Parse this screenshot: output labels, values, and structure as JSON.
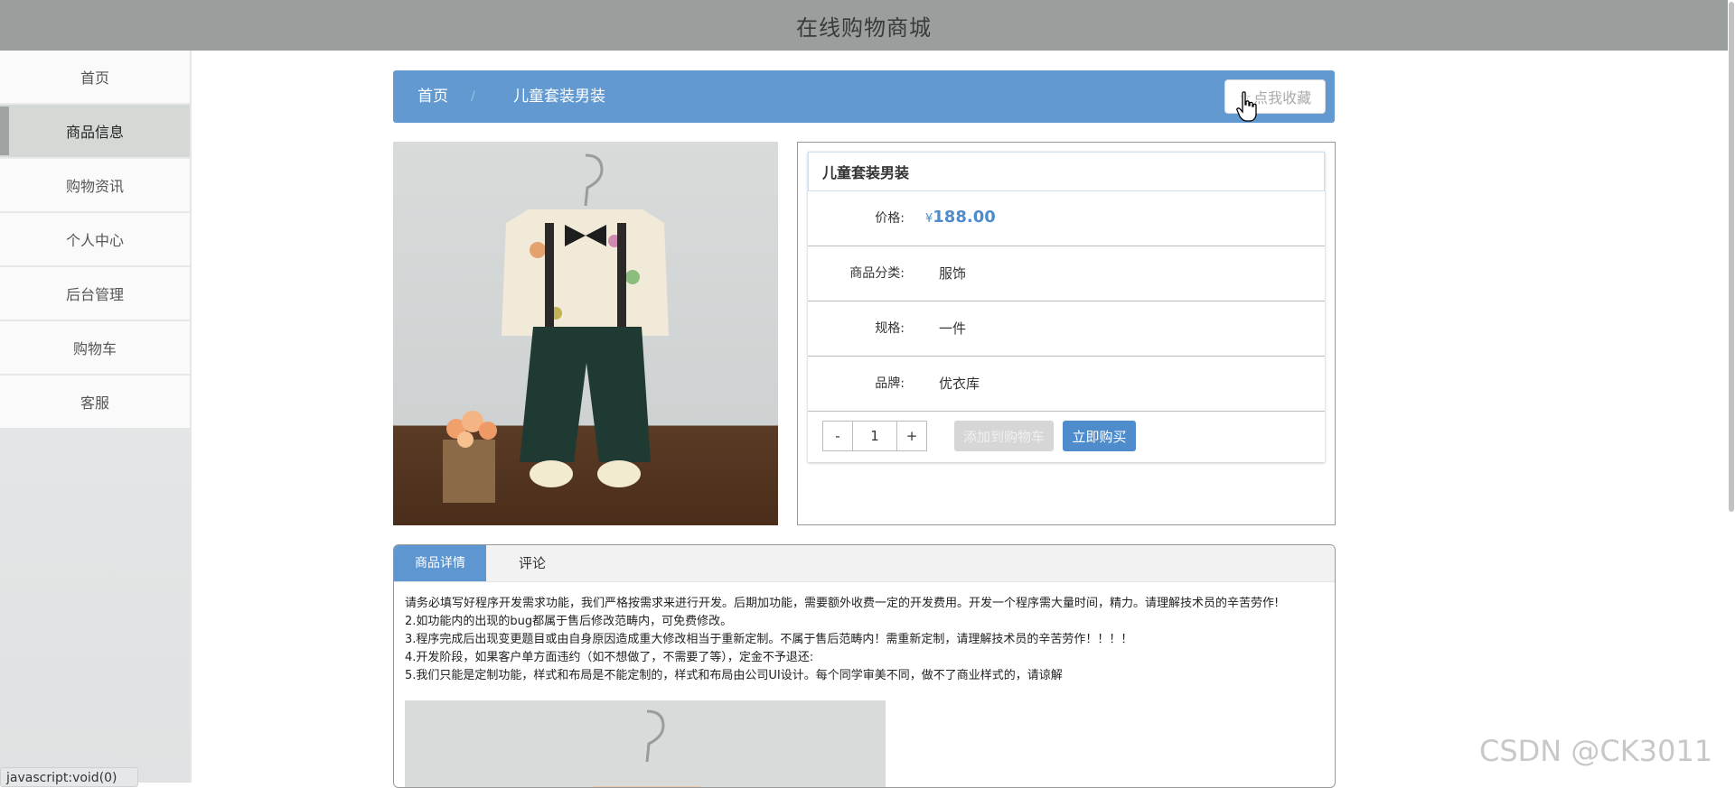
{
  "header": {
    "title": "在线购物商城"
  },
  "sidebar": {
    "items": [
      {
        "label": "首页"
      },
      {
        "label": "商品信息",
        "active": true
      },
      {
        "label": "购物资讯"
      },
      {
        "label": "个人中心"
      },
      {
        "label": "后台管理"
      },
      {
        "label": "购物车"
      },
      {
        "label": "客服"
      }
    ]
  },
  "breadcrumb": {
    "home": "首页",
    "separator": "/",
    "current": "儿童套装男装"
  },
  "favorite_button": {
    "icon": "star-icon",
    "label": "点我收藏"
  },
  "product": {
    "name": "儿童套装男装",
    "price_label": "价格:",
    "currency": "¥",
    "price": "188.00",
    "category_label": "商品分类:",
    "category": "服饰",
    "spec_label": "规格:",
    "spec": "一件",
    "brand_label": "品牌:",
    "brand": "优衣库"
  },
  "quantity": {
    "minus": "-",
    "value": "1",
    "plus": "+"
  },
  "actions": {
    "add_to_cart": "添加到购物车",
    "buy_now": "立即购买"
  },
  "tabs": {
    "details": "商品详情",
    "comments": "评论"
  },
  "details": {
    "lines": [
      "请务必填写好程序开发需求功能，我们严格按需求来进行开发。后期加功能，需要额外收费一定的开发费用。开发一个程序需大量时间，精力。请理解技术员的辛苦劳作!",
      "2.如功能内的出现的bug都属于售后修改范畴内，可免费修改。",
      "3.程序完成后出现变更题目或由自身原因造成重大修改相当于重新定制。不属于售后范畴内！需重新定制，请理解技术员的辛苦劳作！！！！",
      "4.开发阶段，如果客户单方面违约（如不想做了，不需要了等），定金不予退还:",
      "5.我们只能是定制功能，样式和布局是不能定制的，样式和布局由公司UI设计。每个同学审美不同，做不了商业样式的，请谅解"
    ]
  },
  "watermark": "CSDN @CK3011",
  "status_bar": {
    "text": "javascript:void(0)"
  },
  "colors": {
    "accent": "#5d96d1",
    "header": "#9a9e9c",
    "price": "#4f8ccc"
  }
}
